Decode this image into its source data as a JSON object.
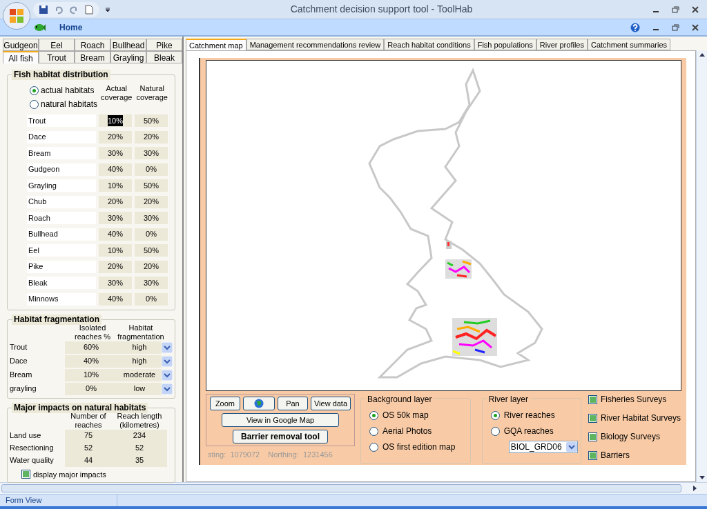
{
  "window": {
    "title": "Catchment decision support tool - ToolHab"
  },
  "ribbon": {
    "tabs": [
      {
        "label": "Home",
        "selected": true
      }
    ]
  },
  "fish_tabs": [
    [
      {
        "label": "Gudgeon",
        "selected": false
      },
      {
        "label": "Eel",
        "selected": false
      },
      {
        "label": "Roach",
        "selected": false
      },
      {
        "label": "Bullhead",
        "selected": false
      },
      {
        "label": "Pike",
        "selected": false
      }
    ],
    [
      {
        "label": "All fish",
        "selected": true
      },
      {
        "label": "Trout",
        "selected": false
      },
      {
        "label": "Bream",
        "selected": false
      },
      {
        "label": "Grayling",
        "selected": false
      },
      {
        "label": "Bleak",
        "selected": false
      }
    ]
  ],
  "habitat_distribution": {
    "title": "Fish habitat distribution",
    "options": [
      {
        "label": "actual habitats",
        "selected": true
      },
      {
        "label": "natural habitats",
        "selected": false
      }
    ],
    "columns": [
      "Actual coverage",
      "Natural coverage"
    ],
    "rows": [
      {
        "name": "Trout",
        "actual": "10%",
        "natural": "50%",
        "highlighted": true
      },
      {
        "name": "Dace",
        "actual": "20%",
        "natural": "20%",
        "highlighted": false
      },
      {
        "name": "Bream",
        "actual": "30%",
        "natural": "30%",
        "highlighted": false
      },
      {
        "name": "Gudgeon",
        "actual": "40%",
        "natural": "0%",
        "highlighted": false
      },
      {
        "name": "Grayling",
        "actual": "10%",
        "natural": "50%",
        "highlighted": false
      },
      {
        "name": "Chub",
        "actual": "20%",
        "natural": "20%",
        "highlighted": false
      },
      {
        "name": "Roach",
        "actual": "30%",
        "natural": "30%",
        "highlighted": false
      },
      {
        "name": "Bullhead",
        "actual": "40%",
        "natural": "0%",
        "highlighted": false
      },
      {
        "name": "Eel",
        "actual": "10%",
        "natural": "50%",
        "highlighted": false
      },
      {
        "name": "Pike",
        "actual": "20%",
        "natural": "20%",
        "highlighted": false
      },
      {
        "name": "Bleak",
        "actual": "30%",
        "natural": "30%",
        "highlighted": false
      },
      {
        "name": "Minnows",
        "actual": "40%",
        "natural": "0%",
        "highlighted": false
      }
    ]
  },
  "habitat_fragmentation": {
    "title": "Habitat fragmentation",
    "columns": [
      "Isolated reaches %",
      "Habitat fragmentation"
    ],
    "rows": [
      {
        "name": "Trout",
        "isolated": "60%",
        "fragmentation": "high"
      },
      {
        "name": "Dace",
        "isolated": "40%",
        "fragmentation": "high"
      },
      {
        "name": "Bream",
        "isolated": "10%",
        "fragmentation": "moderate"
      },
      {
        "name": "grayling",
        "isolated": "0%",
        "fragmentation": "low"
      }
    ]
  },
  "major_impacts": {
    "title": "Major impacts on natural habitats",
    "columns": [
      "Number of reaches",
      "Reach length (kilometres)"
    ],
    "rows": [
      {
        "name": "Land use",
        "reaches": "75",
        "length": "234"
      },
      {
        "name": "Resectioning",
        "reaches": "52",
        "length": "52"
      },
      {
        "name": "Water quality",
        "reaches": "44",
        "length": "35"
      }
    ],
    "display_checkbox": {
      "label": "display major impacts",
      "checked": true
    }
  },
  "main_tabs": [
    {
      "label": "Catchment map",
      "selected": true
    },
    {
      "label": "Management recommendations review",
      "selected": false
    },
    {
      "label": "Reach habitat conditions",
      "selected": false
    },
    {
      "label": "Fish populations",
      "selected": false
    },
    {
      "label": "River profiles",
      "selected": false
    },
    {
      "label": "Catchment summaries",
      "selected": false
    }
  ],
  "map_controls": {
    "buttons": [
      {
        "kind": "text",
        "label": "Zoom"
      },
      {
        "kind": "globe"
      },
      {
        "kind": "text",
        "label": "Pan"
      },
      {
        "kind": "text",
        "label": "View data"
      }
    ],
    "google_button": "View in Google Map",
    "barrier_button": "Barrier removal tool",
    "easting": "sting:  1079072",
    "northing": "Northing:  1231456"
  },
  "background_layer": {
    "title": "Background layer",
    "options": [
      {
        "label": "OS 50k map",
        "selected": true
      },
      {
        "label": "Aerial Photos",
        "selected": false
      },
      {
        "label": "OS first edition map",
        "selected": false
      }
    ]
  },
  "river_layer": {
    "title": "River layer",
    "options": [
      {
        "label": "River reaches",
        "selected": true
      },
      {
        "label": "GQA reaches",
        "selected": false
      }
    ],
    "dropdown": "BIOL_GRD06"
  },
  "layers": [
    {
      "label": "Fisheries Surveys",
      "checked": true
    },
    {
      "label": "River Habitat Surveys",
      "checked": true
    },
    {
      "label": "Biology Surveys",
      "checked": true
    },
    {
      "label": "Barriers",
      "checked": true
    }
  ],
  "status_bar": {
    "text": "Form View"
  }
}
